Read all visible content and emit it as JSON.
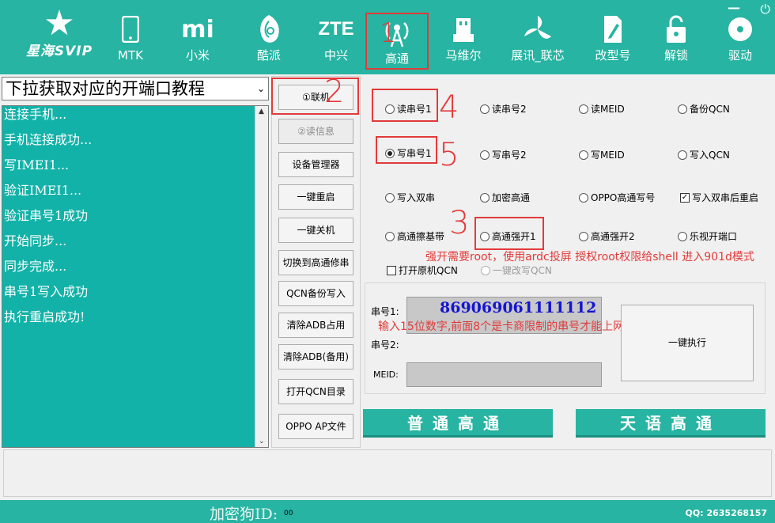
{
  "window": {
    "minimize_glyph": "—",
    "power_glyph": "⏻"
  },
  "logo": {
    "brand": "星海SVIP",
    "icon": "star-face-icon"
  },
  "toolbar": {
    "items": [
      {
        "label": "MTK",
        "icon": "phone-icon"
      },
      {
        "label": "小米",
        "icon": "mi-logo-icon"
      },
      {
        "label": "酷派",
        "icon": "shell-icon"
      },
      {
        "label": "中兴",
        "icon": "zte-logo-icon"
      },
      {
        "label": "高通",
        "icon": "antenna-icon"
      },
      {
        "label": "马维尔",
        "icon": "usb-icon"
      },
      {
        "label": "展讯_联芯",
        "icon": "pinwheel-icon"
      },
      {
        "label": "改型号",
        "icon": "edit-doc-icon"
      },
      {
        "label": "解锁",
        "icon": "unlock-icon"
      },
      {
        "label": "驱动",
        "icon": "disc-icon"
      }
    ],
    "zte_text": "ZTE",
    "mi_text": "mi"
  },
  "dropdown": {
    "selected": "下拉获取对应的开端口教程",
    "arrow": "⌄"
  },
  "log": {
    "lines": [
      "连接手机...",
      "手机连接成功...",
      "写IMEI1...",
      "验证IMEI1...",
      "验证串号1成功",
      "开始同步...",
      "同步完成...",
      "串号1写入成功",
      "执行重启成功!"
    ],
    "scroll_up": "▲",
    "scroll_down": "⌄"
  },
  "buttons": {
    "connect": "①联机",
    "read_info": "②读信息",
    "device_manager": "设备管理器",
    "reboot": "一键重启",
    "shutdown": "一键关机",
    "switch_qualcomm": "切换到高通修串",
    "qcn_backup_write": "QCN备份写入",
    "clear_adb": "清除ADB占用",
    "clear_adb_backup": "清除ADB(备用)",
    "open_qcn_dir": "打开QCN目录",
    "oppo_ap": "OPPO AP文件"
  },
  "options": {
    "read_serial1": "读串号1",
    "read_serial2": "读串号2",
    "read_meid": "读MEID",
    "backup_qcn": "备份QCN",
    "write_serial1": "写串号1",
    "write_serial2": "写串号2",
    "write_meid": "写MEID",
    "write_qcn": "写入QCN",
    "write_dual": "写入双串",
    "encrypt_qualcomm": "加密高通",
    "oppo_write": "OPPO高通写号",
    "reboot_after_dual": "写入双串后重启",
    "qualcomm_wipe_baseband": "高通擦基带",
    "qualcomm_force_open1": "高通强开1",
    "qualcomm_force_open2": "高通强开2",
    "leshi_open_port": "乐视开端口",
    "open_original_qcn": "打开原机QCN",
    "one_click_qcn": "一键改写QCN"
  },
  "annotations": {
    "n1": "1",
    "n2": "2",
    "n3": "3",
    "n4": "4",
    "n5": "5",
    "note_root": "强开需要root，使用ardc投屏 授权root权限给shell 进入901d模式",
    "note_serial": "输入15位数字,前面8个是卡商限制的串号才能上网"
  },
  "serial_group": {
    "serial1_label": "串号1:",
    "serial2_label": "串号2:",
    "meid_label": "MEID:",
    "serial1_value": "869069061111112",
    "execute": "一键执行"
  },
  "big_buttons": {
    "normal": "普通高通",
    "tianyu": "天语高通"
  },
  "footer": {
    "dog_label": "加密狗ID:",
    "dog_value": "00",
    "qq": "QQ: 2635268157"
  }
}
